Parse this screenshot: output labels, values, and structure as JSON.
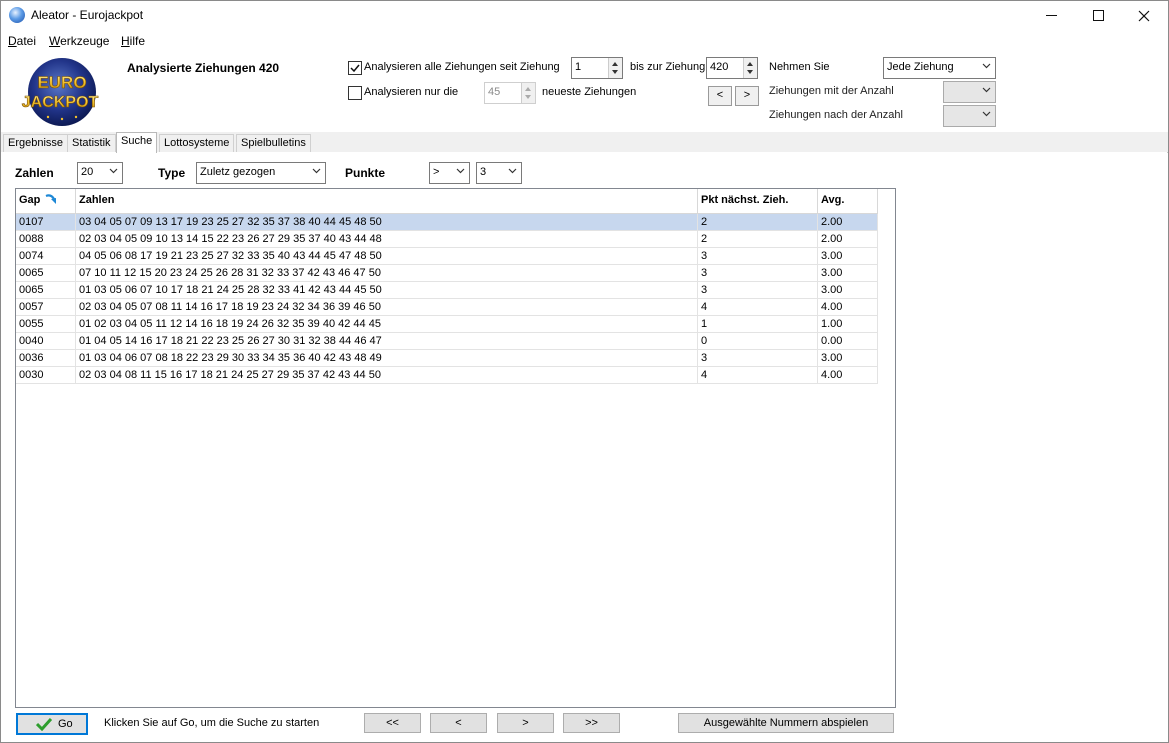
{
  "window": {
    "title": "Aleator - Eurojackpot"
  },
  "menu": [
    {
      "prefix": "",
      "mnemonic": "D",
      "rest": "atei"
    },
    {
      "prefix": "",
      "mnemonic": "W",
      "rest": "erkzeuge"
    },
    {
      "prefix": "",
      "mnemonic": "H",
      "rest": "ilfe"
    }
  ],
  "logo": {
    "line1": "EURO",
    "line2": "JACKPOT"
  },
  "header": {
    "analysed": "Analysierte Ziehungen 420",
    "analyse_all_label": "Analysieren alle Ziehungen seit Ziehung",
    "analyse_all_checked": true,
    "from_value": "1",
    "to_label": "bis zur Ziehung",
    "to_value": "420",
    "analyse_only_label": "Analysieren nur die",
    "analyse_only_checked": false,
    "latest_value": "45",
    "latest_label": "neueste Ziehungen",
    "prev_label": "<",
    "next_label": ">",
    "take_label": "Nehmen Sie",
    "take_value": "Jede Ziehung",
    "with_count_label": "Ziehungen mit der Anzahl",
    "after_count_label": "Ziehungen nach der Anzahl"
  },
  "tabs": [
    "Ergebnisse",
    "Statistik",
    "Suche",
    "Lottosysteme",
    "Spielbulletins"
  ],
  "active_tab": "Suche",
  "filters": {
    "zahlen_label": "Zahlen",
    "zahlen_value": "20",
    "type_label": "Type",
    "type_value": "Zuletz gezogen",
    "punkte_label": "Punkte",
    "punkte_op": ">",
    "punkte_value": "3"
  },
  "grid": {
    "columns": [
      "Gap",
      "Zahlen",
      "Pkt nächst. Zieh.",
      "Avg."
    ],
    "rows": [
      {
        "gap": "0107",
        "zahlen": "03 04 05 07 09 13 17 19 23 25 27 32 35 37 38 40 44 45 48 50",
        "pkt": "2",
        "avg": "2.00"
      },
      {
        "gap": "0088",
        "zahlen": "02 03 04 05 09 10 13 14 15 22 23 26 27 29 35 37 40 43 44 48",
        "pkt": "2",
        "avg": "2.00"
      },
      {
        "gap": "0074",
        "zahlen": "04 05 06 08 17 19 21 23 25 27 32 33 35 40 43 44 45 47 48 50",
        "pkt": "3",
        "avg": "3.00"
      },
      {
        "gap": "0065",
        "zahlen": "07 10 11 12 15 20 23 24 25 26 28 31 32 33 37 42 43 46 47 50",
        "pkt": "3",
        "avg": "3.00"
      },
      {
        "gap": "0065",
        "zahlen": "01 03 05 06 07 10 17 18 21 24 25 28 32 33 41 42 43 44 45 50",
        "pkt": "3",
        "avg": "3.00"
      },
      {
        "gap": "0057",
        "zahlen": "02 03 04 05 07 08 11 14 16 17 18 19 23 24 32 34 36 39 46 50",
        "pkt": "4",
        "avg": "4.00"
      },
      {
        "gap": "0055",
        "zahlen": "01 02 03 04 05 11 12 14 16 18 19 24 26 32 35 39 40 42 44 45",
        "pkt": "1",
        "avg": "1.00"
      },
      {
        "gap": "0040",
        "zahlen": "01 04 05 14 16 17 18 21 22 23 25 26 27 30 31 32 38 44 46 47",
        "pkt": "0",
        "avg": "0.00"
      },
      {
        "gap": "0036",
        "zahlen": "01 03 04 06 07 08 18 22 23 29 30 33 34 35 36 40 42 43 48 49",
        "pkt": "3",
        "avg": "3.00"
      },
      {
        "gap": "0030",
        "zahlen": "02 03 04 08 11 15 16 17 18 21 24 25 27 29 35 37 42 43 44 50",
        "pkt": "4",
        "avg": "4.00"
      }
    ]
  },
  "bottom": {
    "go_label": "Go",
    "hint": "Klicken Sie auf Go, um die Suche zu starten",
    "first_label": "<<",
    "prev_label": "<",
    "next_label": ">",
    "last_label": ">>",
    "play_label": "Ausgewählte Nummern abspielen"
  },
  "colors": {
    "selection": "#c7d7ee",
    "focus": "#0078d7",
    "go_check": "#2e9e2e"
  }
}
